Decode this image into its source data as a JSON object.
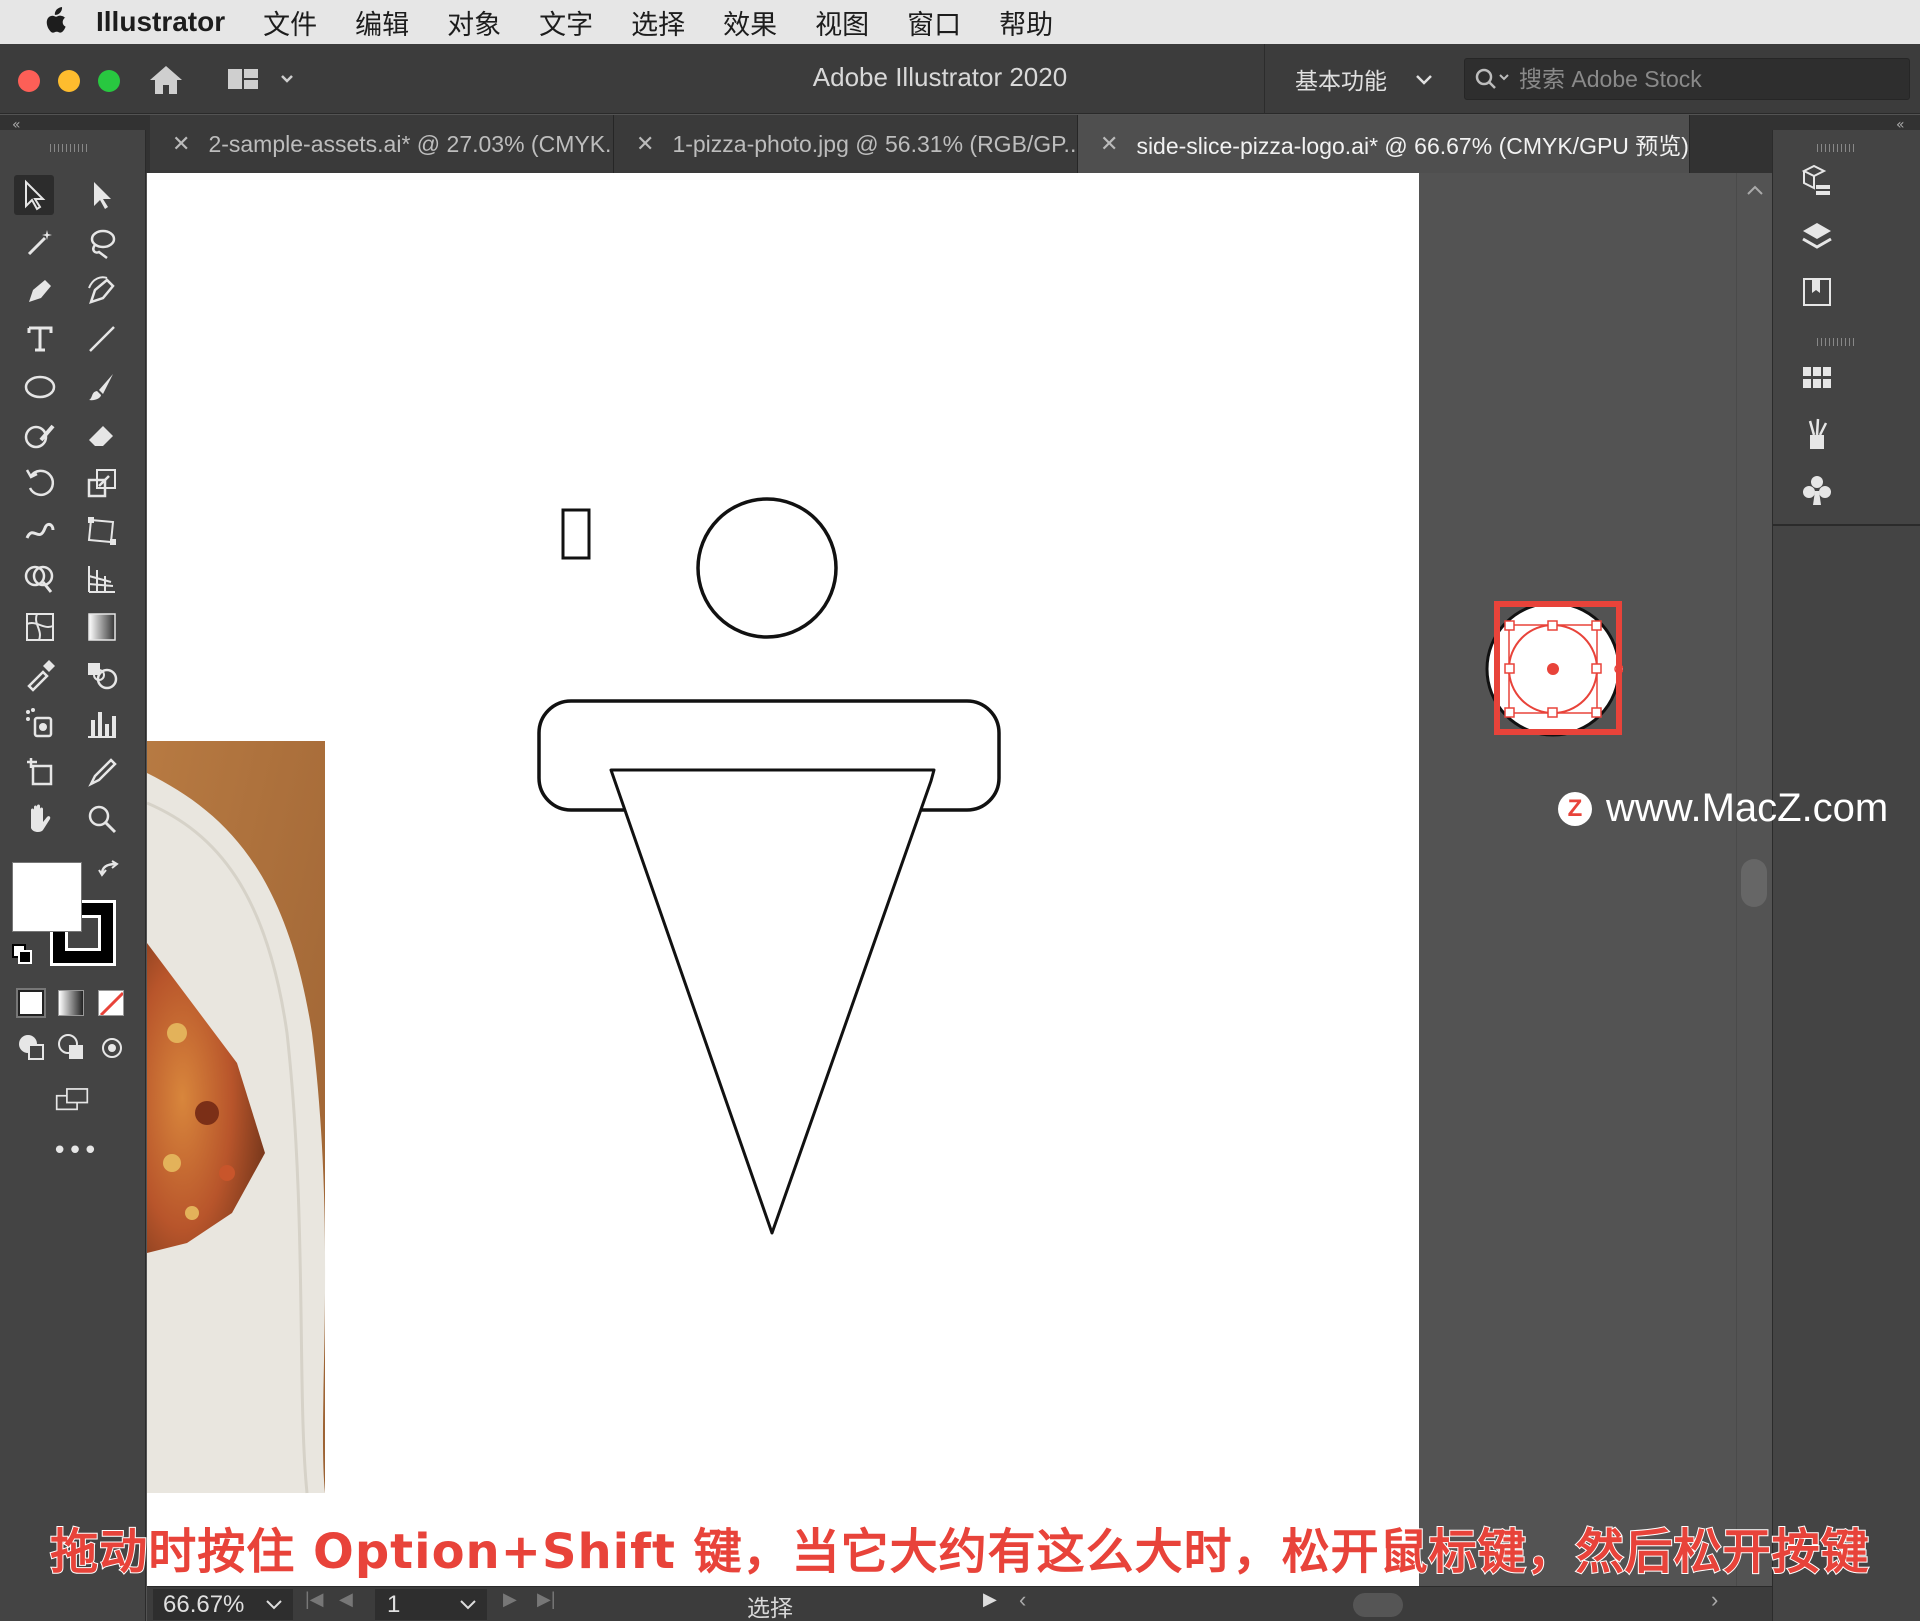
{
  "menubar": {
    "app_name": "Illustrator",
    "items": [
      "文件",
      "编辑",
      "对象",
      "文字",
      "选择",
      "效果",
      "视图",
      "窗口",
      "帮助"
    ]
  },
  "titlebar": {
    "title": "Adobe Illustrator 2020",
    "workspace": "基本功能",
    "search_placeholder": "搜索 Adobe Stock"
  },
  "tabs": [
    {
      "label": "2-sample-assets.ai* @ 27.03% (CMYK...",
      "active": false
    },
    {
      "label": "1-pizza-photo.jpg @ 56.31% (RGB/GP...",
      "active": false
    },
    {
      "label": "side-slice-pizza-logo.ai* @ 66.67% (CMYK/GPU 预览)",
      "active": true
    }
  ],
  "toolbar": {
    "tools": [
      "selection-tool-icon",
      "direct-selection-tool-icon",
      "magic-wand-tool-icon",
      "lasso-tool-icon",
      "pen-tool-icon",
      "curvature-tool-icon",
      "type-tool-icon",
      "line-segment-tool-icon",
      "ellipse-tool-icon",
      "paintbrush-tool-icon",
      "shaper-tool-icon",
      "eraser-tool-icon",
      "rotate-tool-icon",
      "scale-tool-icon",
      "warp-tool-icon",
      "free-transform-tool-icon",
      "shape-builder-tool-icon",
      "perspective-grid-tool-icon",
      "mesh-tool-icon",
      "gradient-tool-icon",
      "eyedropper-tool-icon",
      "blend-tool-icon",
      "symbol-sprayer-tool-icon",
      "column-graph-tool-icon",
      "artboard-tool-icon",
      "slice-tool-icon",
      "hand-tool-icon",
      "zoom-tool-icon"
    ],
    "fill_color": "#ffffff",
    "stroke_color": "#000000",
    "more_label": "•••"
  },
  "right_panel": {
    "icons": [
      "libraries-icon",
      "layers-icon",
      "properties-icon",
      "swatches-icon",
      "brushes-icon",
      "symbols-icon"
    ]
  },
  "status": {
    "zoom": "66.67%",
    "page": "1",
    "tool_label": "选择"
  },
  "caption": "拖动时按住 Option+Shift 键，当它大约有这么大时，松开鼠标键，然后松开按键",
  "watermark": "www.MacZ.com",
  "colors": {
    "highlight": "#e8433a",
    "chrome_dark": "#444444",
    "canvas_bg": "#535353"
  }
}
